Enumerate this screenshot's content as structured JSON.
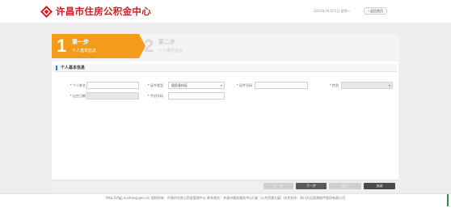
{
  "header": {
    "title": "许昌市住房公积金中心",
    "date_text": "2021年09月01日 星期一",
    "back_label": "返回首页",
    "brand_color": "#c8201f"
  },
  "steps": [
    {
      "number": "1",
      "title": "第一步",
      "subtitle": "个人基本信息",
      "active": true
    },
    {
      "number": "2",
      "title": "第二步",
      "subtitle": "个人缴存信息",
      "active": false
    }
  ],
  "section": {
    "title": "个人基本信息"
  },
  "form": {
    "name_label": "个人姓名",
    "name_value": "",
    "idtype_label": "证件类型",
    "idtype_value": "居民身份证",
    "idno_label": "证件号码",
    "idno_value": "",
    "gender_label": "性别",
    "gender_value": "",
    "birth_label": "出生日期",
    "birth_value": "",
    "phone_label": "手机号码",
    "phone_value": ""
  },
  "buttons": {
    "prev": "上一步",
    "next": "下一步",
    "submit": "提交",
    "close": "关闭"
  },
  "footer": {
    "text": "http://zfgjj.xuchang.gov.cn/ 版权所有：许昌市住房公积金管理中心 联系地址：许昌市政务服务中心C座（公共资源大厦）技术支持：四川久远银海软件股份有限公司"
  },
  "colors": {
    "step_active": "#f29b1c",
    "accent_bar": "#2a7fd4",
    "main_bg": "#eeeeee"
  }
}
